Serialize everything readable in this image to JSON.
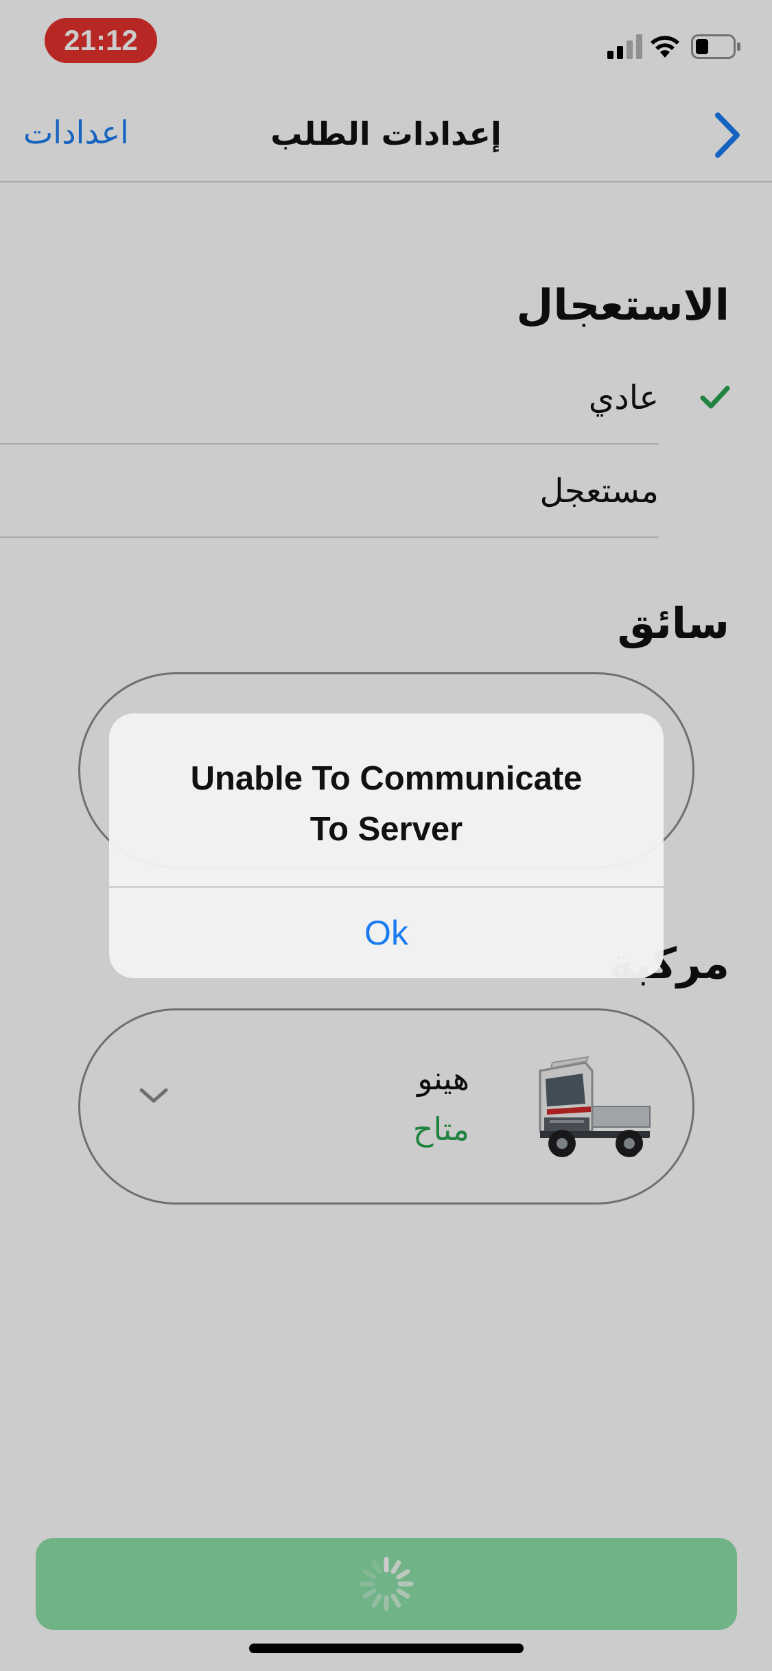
{
  "status_bar": {
    "time": "21:12"
  },
  "nav": {
    "back_label": "اعدادات",
    "title": "إعدادات الطلب"
  },
  "urgency": {
    "title": "الاستعجال",
    "options": [
      {
        "label": "عادي",
        "selected": true
      },
      {
        "label": "مستعجل",
        "selected": false
      }
    ]
  },
  "driver": {
    "title": "سائق"
  },
  "vehicle": {
    "title": "مركبة",
    "selected": {
      "name": "هينو",
      "status": "متاح"
    }
  },
  "alert": {
    "title": "Unable To Communicate To Server",
    "ok_label": "Ok"
  },
  "colors": {
    "accent": "#1a7cf0",
    "success": "#2aa44f",
    "time_pill": "#e5312c",
    "submit_button": "#8be0a8"
  }
}
